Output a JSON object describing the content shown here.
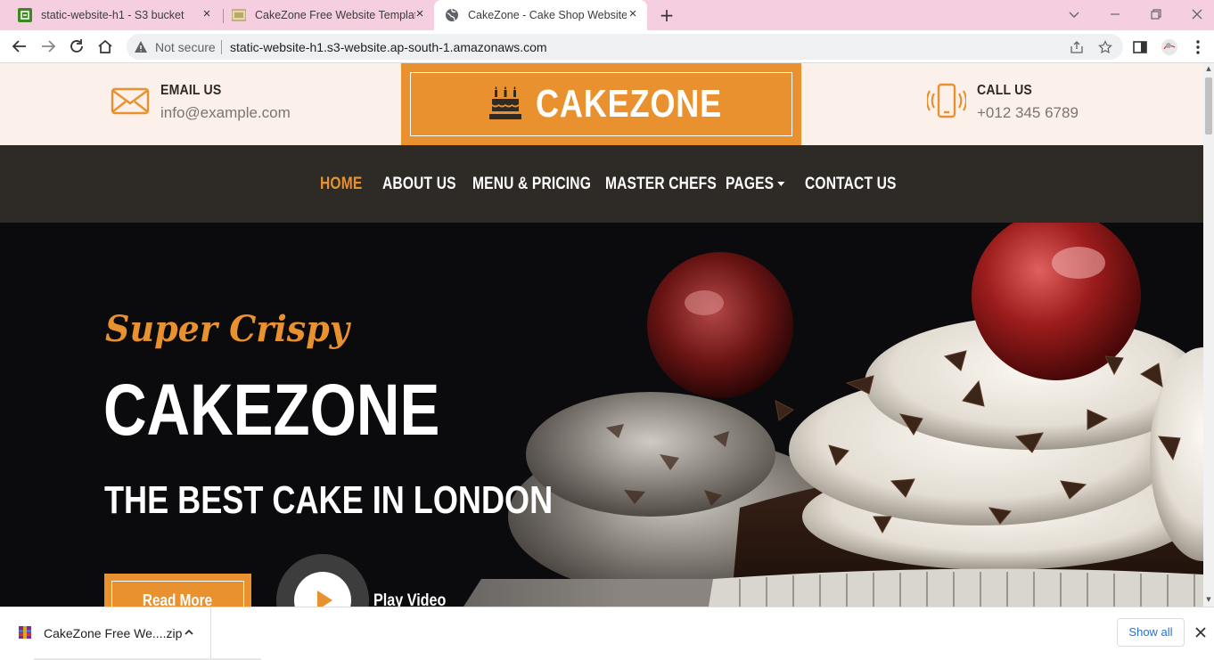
{
  "browser": {
    "tabs": [
      {
        "title": "static-website-h1 - S3 bucket",
        "active": false
      },
      {
        "title": "CakeZone Free Website Template",
        "active": false
      },
      {
        "title": "CakeZone - Cake Shop Website T",
        "active": true
      }
    ],
    "address": {
      "security_label": "Not secure",
      "url": "static-website-h1.s3-website.ap-south-1.amazonaws.com"
    }
  },
  "site": {
    "email": {
      "label": "EMAIL US",
      "value": "info@example.com"
    },
    "phone": {
      "label": "CALL US",
      "value": "+012 345 6789"
    },
    "logo": "CAKEZONE",
    "nav": [
      {
        "label": "HOME",
        "active": true
      },
      {
        "label": "ABOUT US"
      },
      {
        "label": "MENU & PRICING"
      },
      {
        "label": "MASTER CHEFS"
      },
      {
        "label": "PAGES",
        "dropdown": true
      },
      {
        "label": "CONTACT US"
      }
    ],
    "hero": {
      "subtitle": "Super Crispy",
      "title": "CAKEZONE",
      "tagline": "THE BEST CAKE IN LONDON",
      "read_more": "Read More",
      "play_video": "Play Video"
    }
  },
  "downloads": {
    "file": "CakeZone Free We....zip",
    "show_all": "Show all"
  },
  "colors": {
    "accent": "#e8912e",
    "dark": "#2e2a26",
    "cream": "#fbf1ea"
  }
}
